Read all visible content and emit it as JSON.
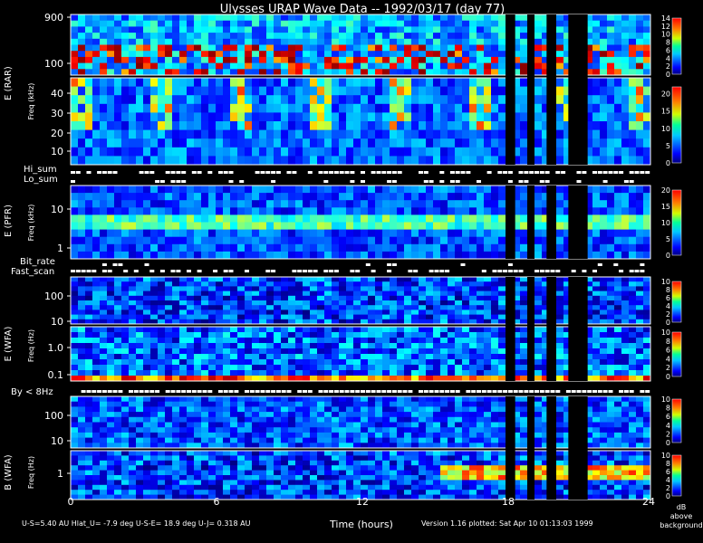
{
  "title": "Ulysses URAP Wave Data -- 1992/03/17  (day 77)",
  "x_axis": {
    "label": "Time (hours)",
    "ticks": [
      "0",
      "6",
      "12",
      "18",
      "24"
    ]
  },
  "footer": {
    "ephemeris": "U-S=5.40 AU   Hlat_U= -7.9 deg   U-S-E= 18.9 deg   U-J= 0.318 AU",
    "version": "Version 1.16 plotted: Sat Apr 10 01:13:03 1999"
  },
  "colorbar_caption": [
    "dB",
    "above",
    "background"
  ],
  "flag_labels": {
    "hi_sum": "Hi_sum",
    "lo_sum": "Lo_sum",
    "bit_rate": "Bit_rate",
    "fast_scan": "Fast_scan",
    "by_8hz": "By < 8Hz"
  },
  "panel_labels": {
    "rar": "E  (RAR)",
    "pfr": "E  (PFR)",
    "e_wfa": "E  (WFA)",
    "b_wfa": "B  (WFA)",
    "freq_khz": "Freq (kHz)",
    "freq_hz": "Freq (Hz)"
  },
  "chart_data": {
    "type": "heatmap",
    "title": "Ulysses URAP Wave Data -- 1992/03/17  (day 77)",
    "xlabel": "Time (hours)",
    "xlim": [
      0,
      24
    ],
    "x_ticks": [
      0,
      6,
      12,
      18,
      24
    ],
    "units": "dB above background",
    "data_gaps_hours": [
      [
        18.0,
        18.4
      ],
      [
        18.9,
        19.2
      ],
      [
        19.7,
        20.1
      ],
      [
        20.6,
        21.4
      ]
    ],
    "panels": [
      {
        "name": "E (RAR) high",
        "ylabel": "Freq (kHz)",
        "scale": "log",
        "y_ticks": [
          "100",
          "900"
        ],
        "colorbar": {
          "min": 0,
          "max": 14,
          "ticks": [
            "0",
            "2",
            "4",
            "6",
            "8",
            "10",
            "12",
            "14"
          ]
        }
      },
      {
        "name": "E (RAR) low",
        "ylabel": "Freq (kHz)",
        "scale": "linear",
        "y_ticks": [
          "10",
          "20",
          "30",
          "40"
        ],
        "colorbar": {
          "min": 0,
          "max": 22,
          "ticks": [
            "0",
            "5",
            "10",
            "15",
            "20"
          ]
        }
      },
      {
        "name": "E (PFR)",
        "ylabel": "Freq (kHz)",
        "scale": "log",
        "y_ticks": [
          "1",
          "10"
        ],
        "colorbar": {
          "min": 0,
          "max": 20,
          "ticks": [
            "0",
            "5",
            "10",
            "15",
            "20"
          ]
        }
      },
      {
        "name": "E (WFA) high",
        "ylabel": "Freq (Hz)",
        "scale": "log",
        "y_ticks": [
          "10",
          "100"
        ],
        "colorbar": {
          "min": 0,
          "max": 10,
          "ticks": [
            "0",
            "2",
            "4",
            "6",
            "8",
            "10"
          ]
        }
      },
      {
        "name": "E (WFA) low",
        "ylabel": "Freq (Hz)",
        "scale": "log",
        "y_ticks": [
          "0.1",
          "1.0"
        ],
        "colorbar": {
          "min": 0,
          "max": 10,
          "ticks": [
            "0",
            "2",
            "4",
            "6",
            "8",
            "10"
          ]
        }
      },
      {
        "name": "B (WFA) high",
        "ylabel": "Freq (Hz)",
        "scale": "log",
        "y_ticks": [
          "10",
          "100"
        ],
        "colorbar": {
          "min": 0,
          "max": 10,
          "ticks": [
            "0",
            "2",
            "4",
            "6",
            "8",
            "10"
          ]
        }
      },
      {
        "name": "B (WFA) low",
        "ylabel": "Freq (Hz)",
        "scale": "log",
        "y_ticks": [
          "1"
        ],
        "colorbar": {
          "min": 0,
          "max": 10,
          "ticks": [
            "0",
            "2",
            "4",
            "6",
            "8",
            "10"
          ]
        }
      }
    ],
    "flag_bars": [
      "Hi_sum",
      "Lo_sum",
      "Bit_rate",
      "Fast_scan",
      "By < 8Hz"
    ]
  }
}
